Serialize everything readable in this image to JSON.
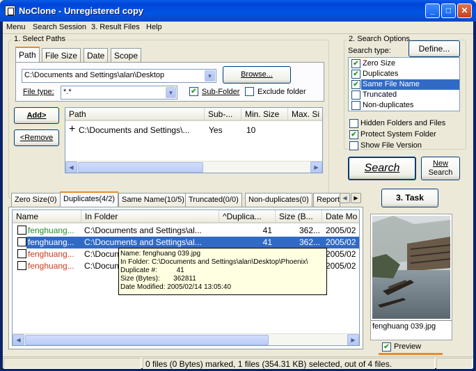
{
  "window": {
    "title": "NoClone - Unregistered copy",
    "min": "_",
    "max": "□",
    "close": "✕"
  },
  "menu": [
    "Menu",
    "Search Session",
    "3. Result Files",
    "Help"
  ],
  "select_paths": {
    "group_label": "1. Select Paths",
    "tabs": [
      "Path",
      "File Size",
      "Date",
      "Scope"
    ],
    "path_value": "C:\\Documents and Settings\\alan\\Desktop",
    "browse": "Browse...",
    "filetype_label": "File type:",
    "filetype_value": "*.*",
    "subfolder_label": "Sub-Folder",
    "subfolder_checked": true,
    "exclude_label": "Exclude folder",
    "exclude_checked": false,
    "add": "Add>",
    "remove": "<Remove",
    "columns": [
      "Path",
      "Sub-...",
      "Min. Size",
      "Max. Si"
    ],
    "rows": [
      {
        "path": "C:\\Documents and Settings\\...",
        "sub": "Yes",
        "min": "10",
        "max": ""
      }
    ]
  },
  "search_options": {
    "group_label": "2. Search Options",
    "type_label": "Search type:",
    "define": "Define...",
    "types": [
      {
        "label": "Zero Size",
        "checked": true,
        "selected": false
      },
      {
        "label": "Duplicates",
        "checked": true,
        "selected": false
      },
      {
        "label": "Same File Name",
        "checked": true,
        "selected": true
      },
      {
        "label": "Truncated",
        "checked": false,
        "selected": false
      },
      {
        "label": "Non-duplicates",
        "checked": false,
        "selected": false
      }
    ],
    "hidden": {
      "label": "Hidden Folders and Files",
      "checked": false
    },
    "protect": {
      "label": "Protect System Folder",
      "checked": true
    },
    "version": {
      "label": "Show File Version",
      "checked": false
    }
  },
  "search_button": "Search",
  "new_search": {
    "line1": "New",
    "line2": "Search"
  },
  "task_button": "3. Task",
  "result_tabs": [
    "Zero Size(0)",
    "Duplicates(4/2)",
    "Same Name(10/5)",
    "Truncated(0/0)",
    "Non-duplicates(0)",
    "Report"
  ],
  "result_columns": [
    "Name",
    "In Folder",
    "^Duplica...",
    "Size (B...",
    "Date Mo"
  ],
  "result_rows": [
    {
      "name": "fenghuang...",
      "folder": "C:\\Documents and Settings\\al...",
      "dup": "41",
      "size": "362...",
      "date": "2005/02",
      "color": "#2a8a2a",
      "selected": false
    },
    {
      "name": "fenghuang...",
      "folder": "C:\\Documents and Settings\\al...",
      "dup": "41",
      "size": "362...",
      "date": "2005/02",
      "color": "#ffffff",
      "selected": true
    },
    {
      "name": "fenghuang...",
      "folder": "C:\\Docun",
      "dup": "",
      "size": "",
      "date": "2005/02",
      "color": "#d03a1a",
      "selected": false
    },
    {
      "name": "fenghuang...",
      "folder": "C:\\Docun",
      "dup": "",
      "size": "",
      "date": "2005/02",
      "color": "#d03a1a",
      "selected": false
    }
  ],
  "tooltip": [
    "Name: fenghuang 039.jpg",
    "In Folder: C:\\Documents and Settings\\alan\\Desktop\\Phoenix\\",
    "Duplicate #:          41",
    "Size (Bytes):       362811",
    "Date Modified: 2005/02/14 13:05:40"
  ],
  "preview": {
    "filename": "fenghuang 039.jpg",
    "label": "Preview",
    "checked": true
  },
  "status": "0 files (0 Bytes) marked, 1 files (354.31 KB) selected, out of 4 files.",
  "colors": {
    "selection": "#316ac5",
    "accent": "#e68b2c"
  }
}
